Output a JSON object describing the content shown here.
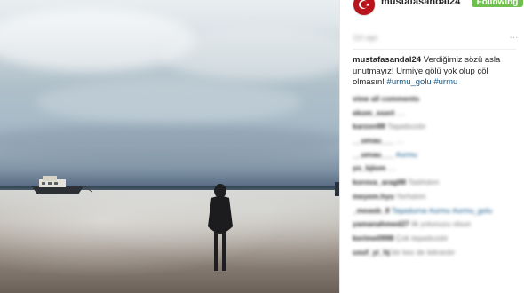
{
  "post": {
    "username": "mustafasandal24",
    "follow_label": "Following",
    "timestamp": "11h ago",
    "more_label": "…"
  },
  "caption": {
    "username": "mustafasandal24",
    "text": "Verdiğimiz sözü asla unutmayız! Urmiye gölü yok olup çöl olmasın!",
    "hashtags": "#urmu_golu #urmu"
  },
  "comments": [
    {
      "user": "view all comments",
      "text": ""
    },
    {
      "user": "ekom_esert",
      "text": "...."
    },
    {
      "user": "karzon98",
      "text": "Taşadsızdır"
    },
    {
      "user": "__umau___",
      "text": "...."
    },
    {
      "user": "__umau___",
      "text": "#urmu"
    },
    {
      "user": "yo_bjiom",
      "text": "...."
    },
    {
      "user": "korova_arag98",
      "text": "Tadıhdım"
    },
    {
      "user": "meyem.hyu",
      "text": "Yerhalım"
    },
    {
      "user": "_moasb_8",
      "text": "Taşadurna #urmu #urmu_golu"
    },
    {
      "user": "yamanahmed27",
      "text": "ilk yolunuzu olsun"
    },
    {
      "user": "kerime0998",
      "text": "Çok taşadsızdır"
    },
    {
      "user": "usuf_yi_hj",
      "text": "bir kez de tekrardır"
    }
  ],
  "icons": {
    "avatar": "crescent-star-icon"
  },
  "colors": {
    "follow_bg": "#70c050",
    "hashtag": "#125688",
    "avatar_bg": "#b8141c"
  }
}
